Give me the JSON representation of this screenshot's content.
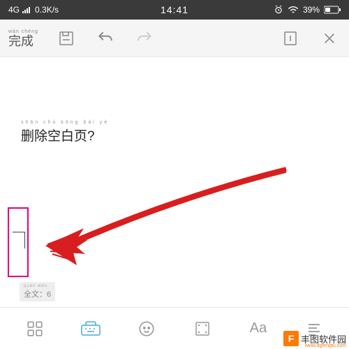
{
  "status": {
    "network": "4G",
    "speed": "0.3K/s",
    "time": "14:41",
    "battery": "39%"
  },
  "toolbar": {
    "done_pinyin": "wán chéng",
    "done_label": "完成"
  },
  "content": {
    "pinyin": "shān chú kōng bái yè",
    "text": "删除空白页?"
  },
  "footer": {
    "count_pinyin": "quán wén",
    "count_label": "全文：6"
  },
  "watermark": {
    "logo": "F",
    "name": "丰图软件园",
    "url": "www.dgfengtu.com"
  }
}
